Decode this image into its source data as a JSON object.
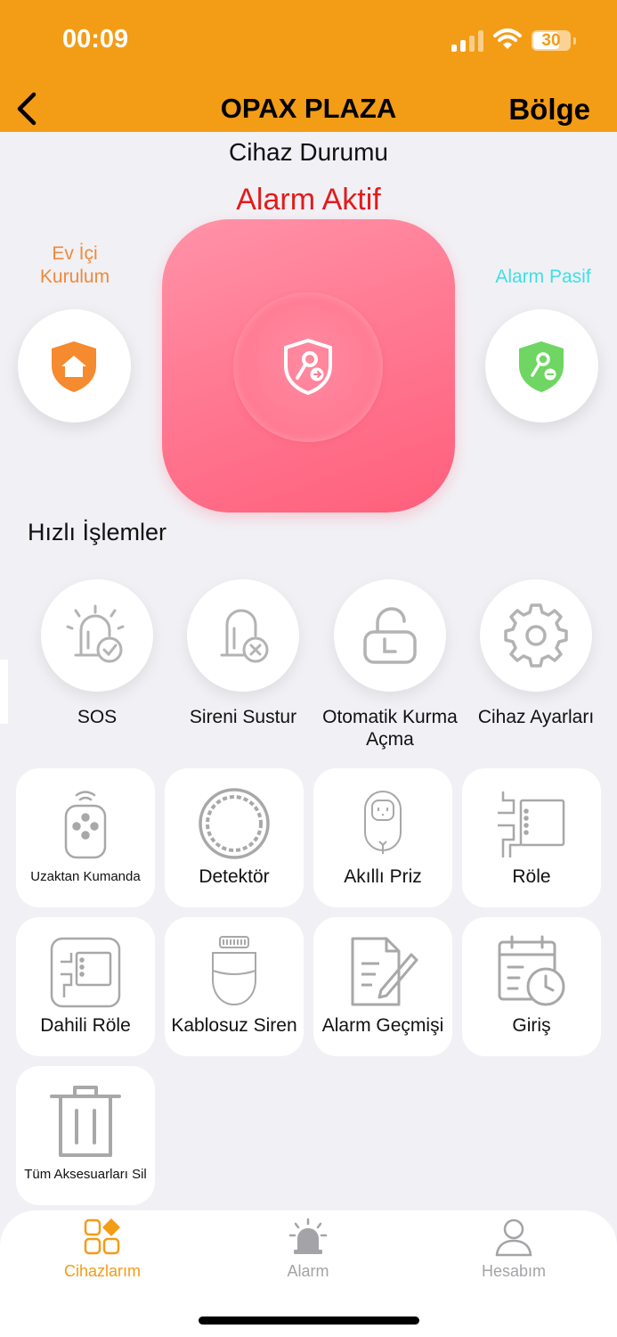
{
  "status_bar": {
    "time": "00:09",
    "battery": "30"
  },
  "header": {
    "title": "OPAX PLAZA",
    "region_label": "Bölge"
  },
  "device_status": {
    "heading": "Cihaz Durumu",
    "state": "Alarm Aktif"
  },
  "modes": {
    "home": {
      "label": "Ev İçi Kurulum"
    },
    "pasif": {
      "label": "Alarm Pasif"
    }
  },
  "quick_actions": {
    "title": "Hızlı İşlemler",
    "items": [
      {
        "label": "SOS",
        "icon": "siren-check-icon"
      },
      {
        "label": "Sireni Sustur",
        "icon": "siren-mute-icon"
      },
      {
        "label": "Otomatik Kurma Açma",
        "icon": "timer-lock-icon"
      },
      {
        "label": "Cihaz Ayarları",
        "icon": "gear-icon"
      }
    ]
  },
  "devices": [
    {
      "label": "Uzaktan Kumanda",
      "icon": "remote-control-icon"
    },
    {
      "label": "Detektör",
      "icon": "detector-icon"
    },
    {
      "label": "Akıllı Priz",
      "icon": "smart-plug-icon"
    },
    {
      "label": "Röle",
      "icon": "relay-icon"
    },
    {
      "label": "Dahili Röle",
      "icon": "internal-relay-icon"
    },
    {
      "label": "Kablosuz Siren",
      "icon": "wireless-siren-icon"
    },
    {
      "label": "Alarm Geçmişi",
      "icon": "history-icon"
    },
    {
      "label": "Giriş",
      "icon": "calendar-clock-icon"
    },
    {
      "label": "Tüm Aksesuarları Sil",
      "icon": "trash-icon"
    }
  ],
  "tabs": [
    {
      "label": "Cihazlarım",
      "active": true
    },
    {
      "label": "Alarm",
      "active": false
    },
    {
      "label": "Hesabım",
      "active": false
    }
  ],
  "colors": {
    "accent": "#f39c16",
    "alarm_red": "#e31b1b",
    "home_orange": "#f0893b",
    "pasif_cyan": "#3de0e6",
    "pink": "#ff7a93"
  }
}
